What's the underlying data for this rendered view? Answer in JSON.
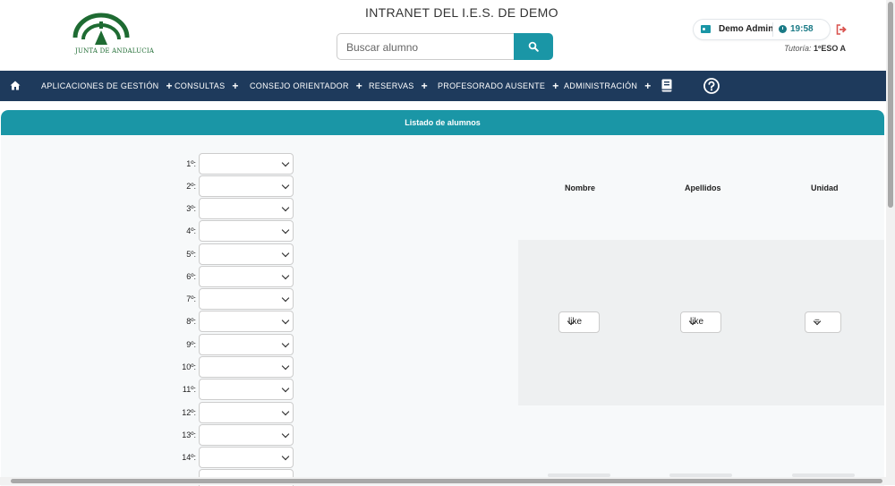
{
  "header": {
    "logo_text": "JUNTA DE ANDALUCIA",
    "site_title": "INTRANET DEL I.E.S. DE DEMO",
    "search": {
      "placeholder": "Buscar alumno",
      "value": ""
    },
    "user": {
      "name": "Demo Admin",
      "time": "19:58"
    },
    "tutoria": {
      "label": "Tutoría:",
      "value": "1ºESO A"
    }
  },
  "nav": {
    "items": [
      {
        "label": "APLICACIONES DE GESTIÓN"
      },
      {
        "label": "CONSULTAS"
      },
      {
        "label": "CONSEJO ORIENTADOR"
      },
      {
        "label": "RESERVAS"
      },
      {
        "label": "PROFESORADO AUSENTE"
      },
      {
        "label": "ADMINISTRACIÓN"
      }
    ],
    "plus": "+"
  },
  "panel": {
    "title": "Listado de alumnos",
    "order_labels": [
      "1º:",
      "2º:",
      "3º:",
      "4º:",
      "5º:",
      "6º:",
      "7º:",
      "8º:",
      "9º:",
      "10º:",
      "11º:",
      "12º:",
      "13º:",
      "14º:"
    ],
    "columns": [
      "Nombre",
      "Apellidos",
      "Unidad"
    ],
    "operators": [
      "like",
      "like",
      "="
    ]
  },
  "colors": {
    "accent": "#1a96a6",
    "navbar": "#1e3a5c",
    "logo_green": "#1e6b32",
    "logout_red": "#d9534f"
  }
}
